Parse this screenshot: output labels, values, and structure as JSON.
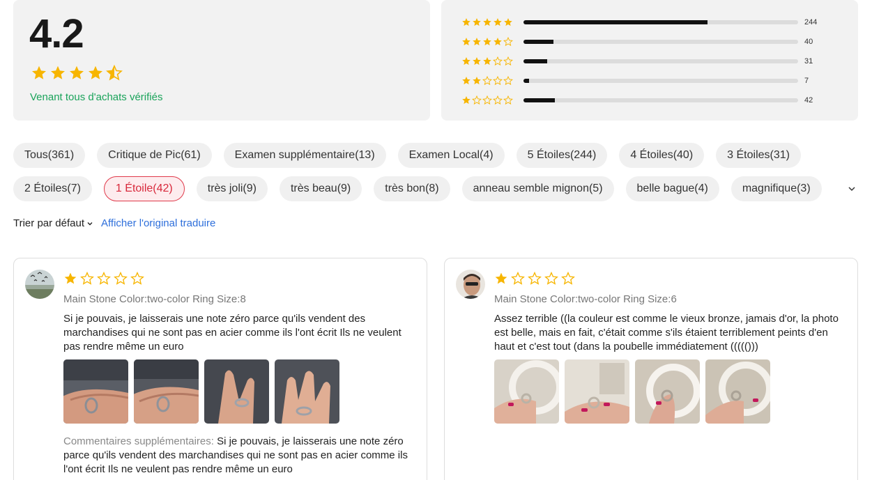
{
  "summary": {
    "rating": "4.2",
    "rating_value": 4.2,
    "verified_text": "Venant tous d'achats vérifiés"
  },
  "distribution": [
    {
      "stars": 5,
      "count": "244",
      "value": 244
    },
    {
      "stars": 4,
      "count": "40",
      "value": 40
    },
    {
      "stars": 3,
      "count": "31",
      "value": 31
    },
    {
      "stars": 2,
      "count": "7",
      "value": 7
    },
    {
      "stars": 1,
      "count": "42",
      "value": 42
    }
  ],
  "filters": {
    "row1": [
      "Tous(361)",
      "Critique de Pic(61)",
      "Examen supplémentaire(13)",
      "Examen Local(4)",
      "5 Étoiles(244)",
      "4 Étoiles(40)",
      "3 Étoiles(31)"
    ],
    "row2": [
      "2 Étoiles(7)",
      "1 Étoile(42)",
      "très joli(9)",
      "très beau(9)",
      "très bon(8)",
      "anneau semble mignon(5)",
      "belle bague(4)",
      "magnifique(3)"
    ],
    "active": "1 Étoile(42)"
  },
  "sort": {
    "label": "Trier par défaut",
    "original_link": "Afficher l'original traduire"
  },
  "reviews": [
    {
      "stars": 1,
      "sku": "Main Stone Color:two-color Ring Size:8",
      "text": "Si je pouvais, je laisserais une note zéro parce qu'ils vendent des marchandises qui ne sont pas en acier comme ils l'ont écrit Ils ne veulent pas rendre même un euro",
      "extra_label": "Commentaires supplémentaires: ",
      "extra_text": "Si je pouvais, je laisserais une note zéro parce qu'ils vendent des marchandises qui ne sont pas en acier comme ils l'ont écrit Ils ne veulent pas rendre même un euro",
      "photo_count": 4
    },
    {
      "stars": 1,
      "sku": "Main Stone Color:two-color Ring Size:6",
      "text": "Assez terrible ((la couleur est comme le vieux bronze, jamais d'or, la photo est belle, mais en fait, c'était comme s'ils étaient terriblement peints d'en haut et c'est tout (dans la poubelle immédiatement ((((()))",
      "photo_count": 4
    }
  ],
  "colors": {
    "star": "#f7b500",
    "star_empty_stroke": "#f7b500",
    "verified": "#1aa35a",
    "link": "#2e6fdb",
    "active_chip": "#e03a4b",
    "bar_fill": "#111111",
    "bar_track": "#dcdcdc"
  },
  "icons": {
    "star": "star-icon",
    "sort_chevron": "chevron-down-icon",
    "expand_chips": "chevron-down-icon"
  }
}
